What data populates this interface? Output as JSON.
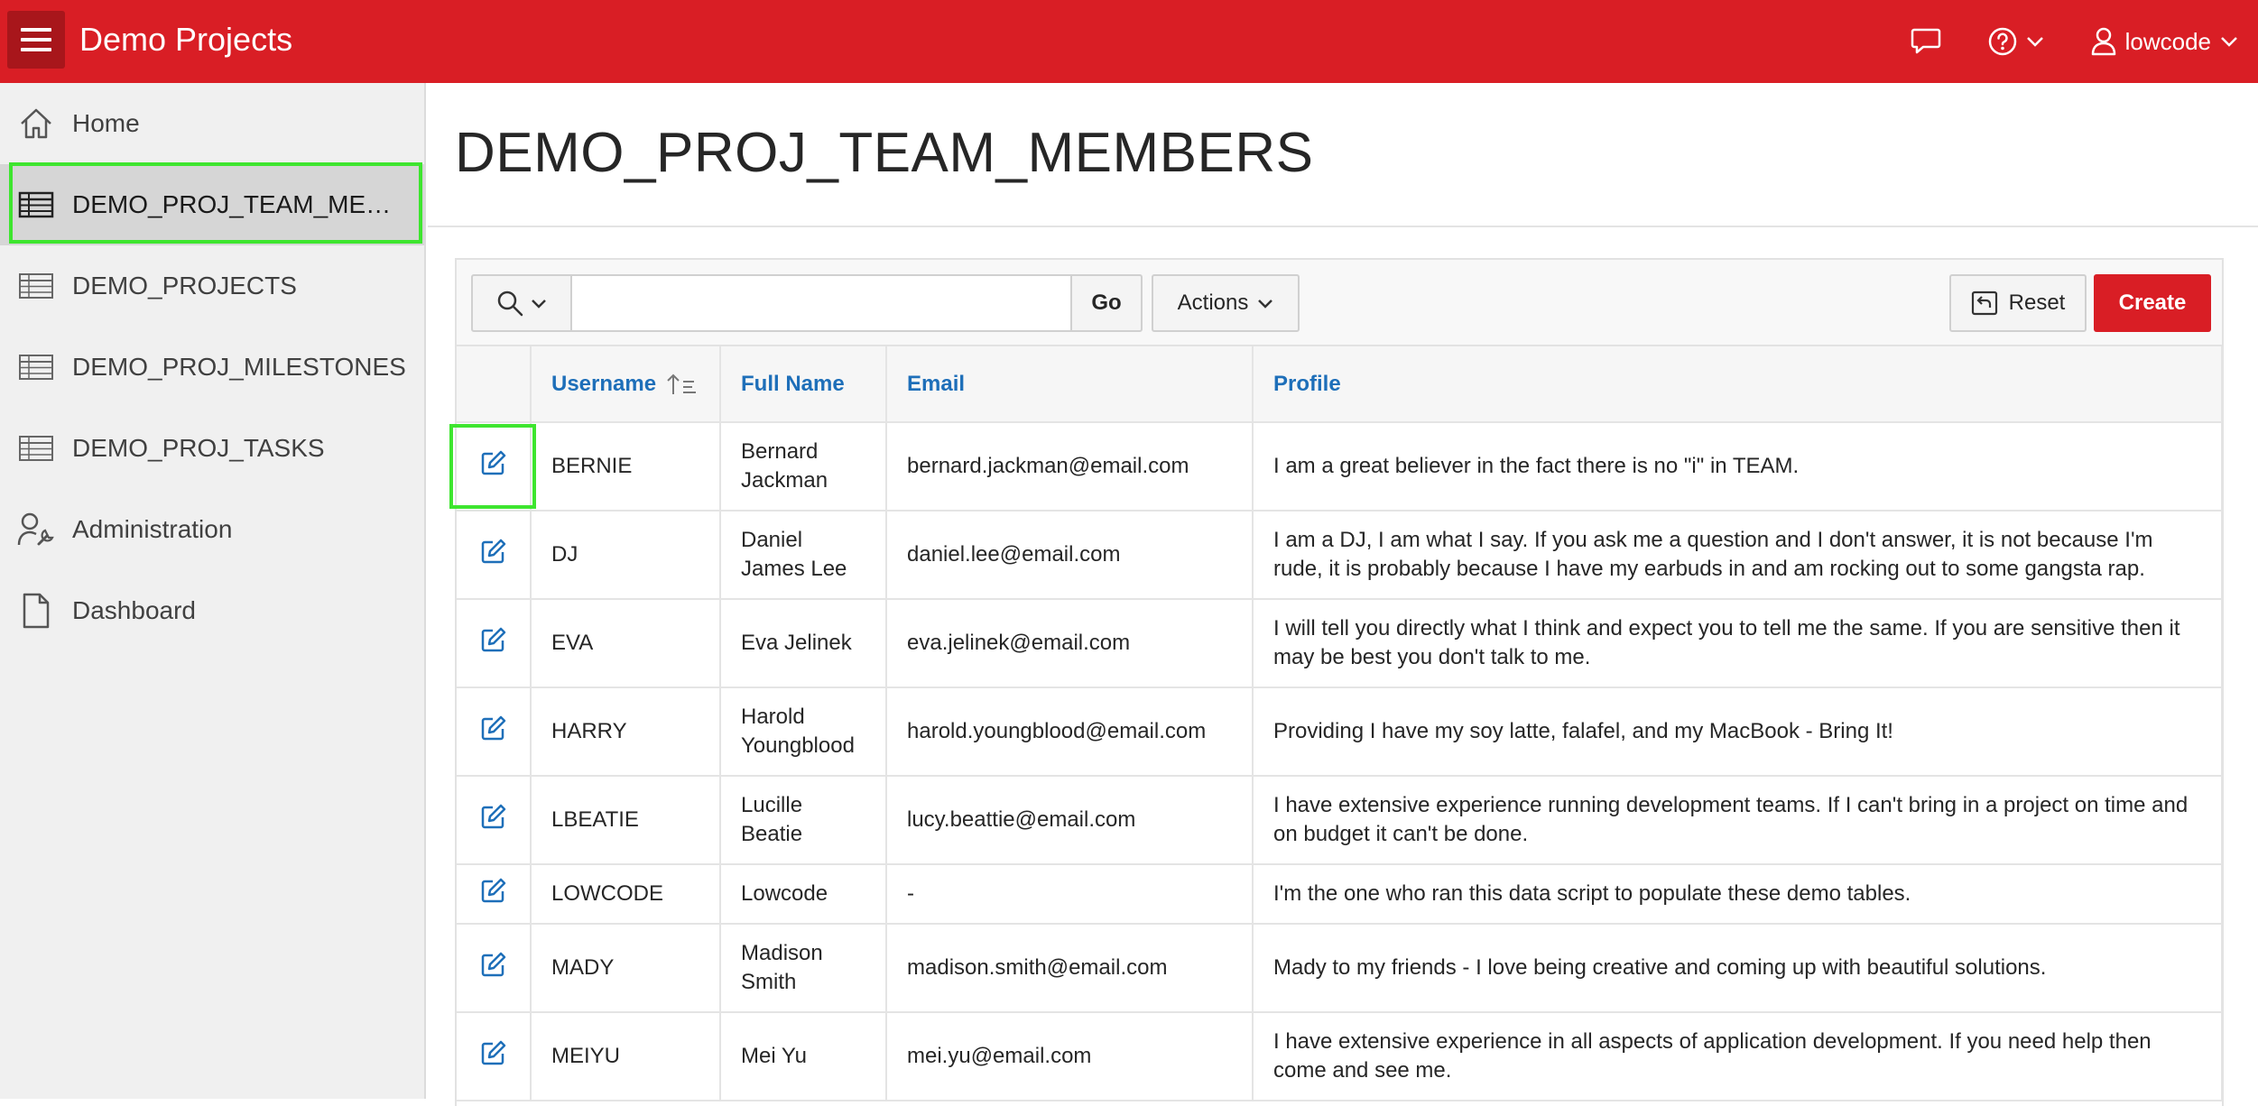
{
  "header": {
    "app_title": "Demo Projects",
    "user_name": "lowcode",
    "icons": [
      "menu-icon",
      "chat-icon",
      "help-icon",
      "user-icon"
    ]
  },
  "sidebar": {
    "items": [
      {
        "label": "Home",
        "icon": "home-icon"
      },
      {
        "label": "DEMO_PROJ_TEAM_MEMBERS",
        "icon": "table-icon",
        "active": true
      },
      {
        "label": "DEMO_PROJECTS",
        "icon": "table-icon"
      },
      {
        "label": "DEMO_PROJ_MILESTONES",
        "icon": "table-icon"
      },
      {
        "label": "DEMO_PROJ_TASKS",
        "icon": "table-icon"
      },
      {
        "label": "Administration",
        "icon": "user-wrench-icon"
      },
      {
        "label": "Dashboard",
        "icon": "file-icon"
      }
    ]
  },
  "main": {
    "page_title": "DEMO_PROJ_TEAM_MEMBERS",
    "toolbar": {
      "search_value": "",
      "go_label": "Go",
      "actions_label": "Actions",
      "reset_label": "Reset",
      "create_label": "Create"
    },
    "table": {
      "columns": [
        "Username",
        "Full Name",
        "Email",
        "Profile"
      ],
      "sort_column": "Username",
      "rows": [
        {
          "username": "BERNIE",
          "full_name": "Bernard Jackman",
          "email": "bernard.jackman@email.com",
          "profile": "I am a great believer in the fact there is no \"i\" in TEAM."
        },
        {
          "username": "DJ",
          "full_name": "Daniel James Lee",
          "email": "daniel.lee@email.com",
          "profile": "I am a DJ, I am what I say. If you ask me a question and I don't answer, it is not because I'm rude, it is probably because I have my earbuds in and am rocking out to some gangsta rap."
        },
        {
          "username": "EVA",
          "full_name": "Eva Jelinek",
          "email": "eva.jelinek@email.com",
          "profile": "I will tell you directly what I think and expect you to tell me the same. If you are sensitive then it may be best you don't talk to me."
        },
        {
          "username": "HARRY",
          "full_name": "Harold Youngblood",
          "email": "harold.youngblood@email.com",
          "profile": "Providing I have my soy latte, falafel, and my MacBook - Bring It!"
        },
        {
          "username": "LBEATIE",
          "full_name": "Lucille Beatie",
          "email": "lucy.beattie@email.com",
          "profile": "I have extensive experience running development teams. If I can't bring in a project on time and on budget it can't be done."
        },
        {
          "username": "LOWCODE",
          "full_name": "Lowcode",
          "email": "-",
          "profile": "I'm the one who ran this data script to populate these demo tables."
        },
        {
          "username": "MADY",
          "full_name": "Madison Smith",
          "email": "madison.smith@email.com",
          "profile": "Mady to my friends - I love being creative and coming up with beautiful solutions."
        },
        {
          "username": "MEIYU",
          "full_name": "Mei Yu",
          "email": "mei.yu@email.com",
          "profile": "I have extensive experience in all aspects of application development. If you need help then come and see me."
        }
      ]
    }
  },
  "colors": {
    "header_bg": "#d91e25",
    "menu_btn_bg": "#a8161b",
    "link_blue": "#1e6fb9",
    "highlight_green": "#3ee52f",
    "sidebar_bg": "#f0f0f0"
  }
}
